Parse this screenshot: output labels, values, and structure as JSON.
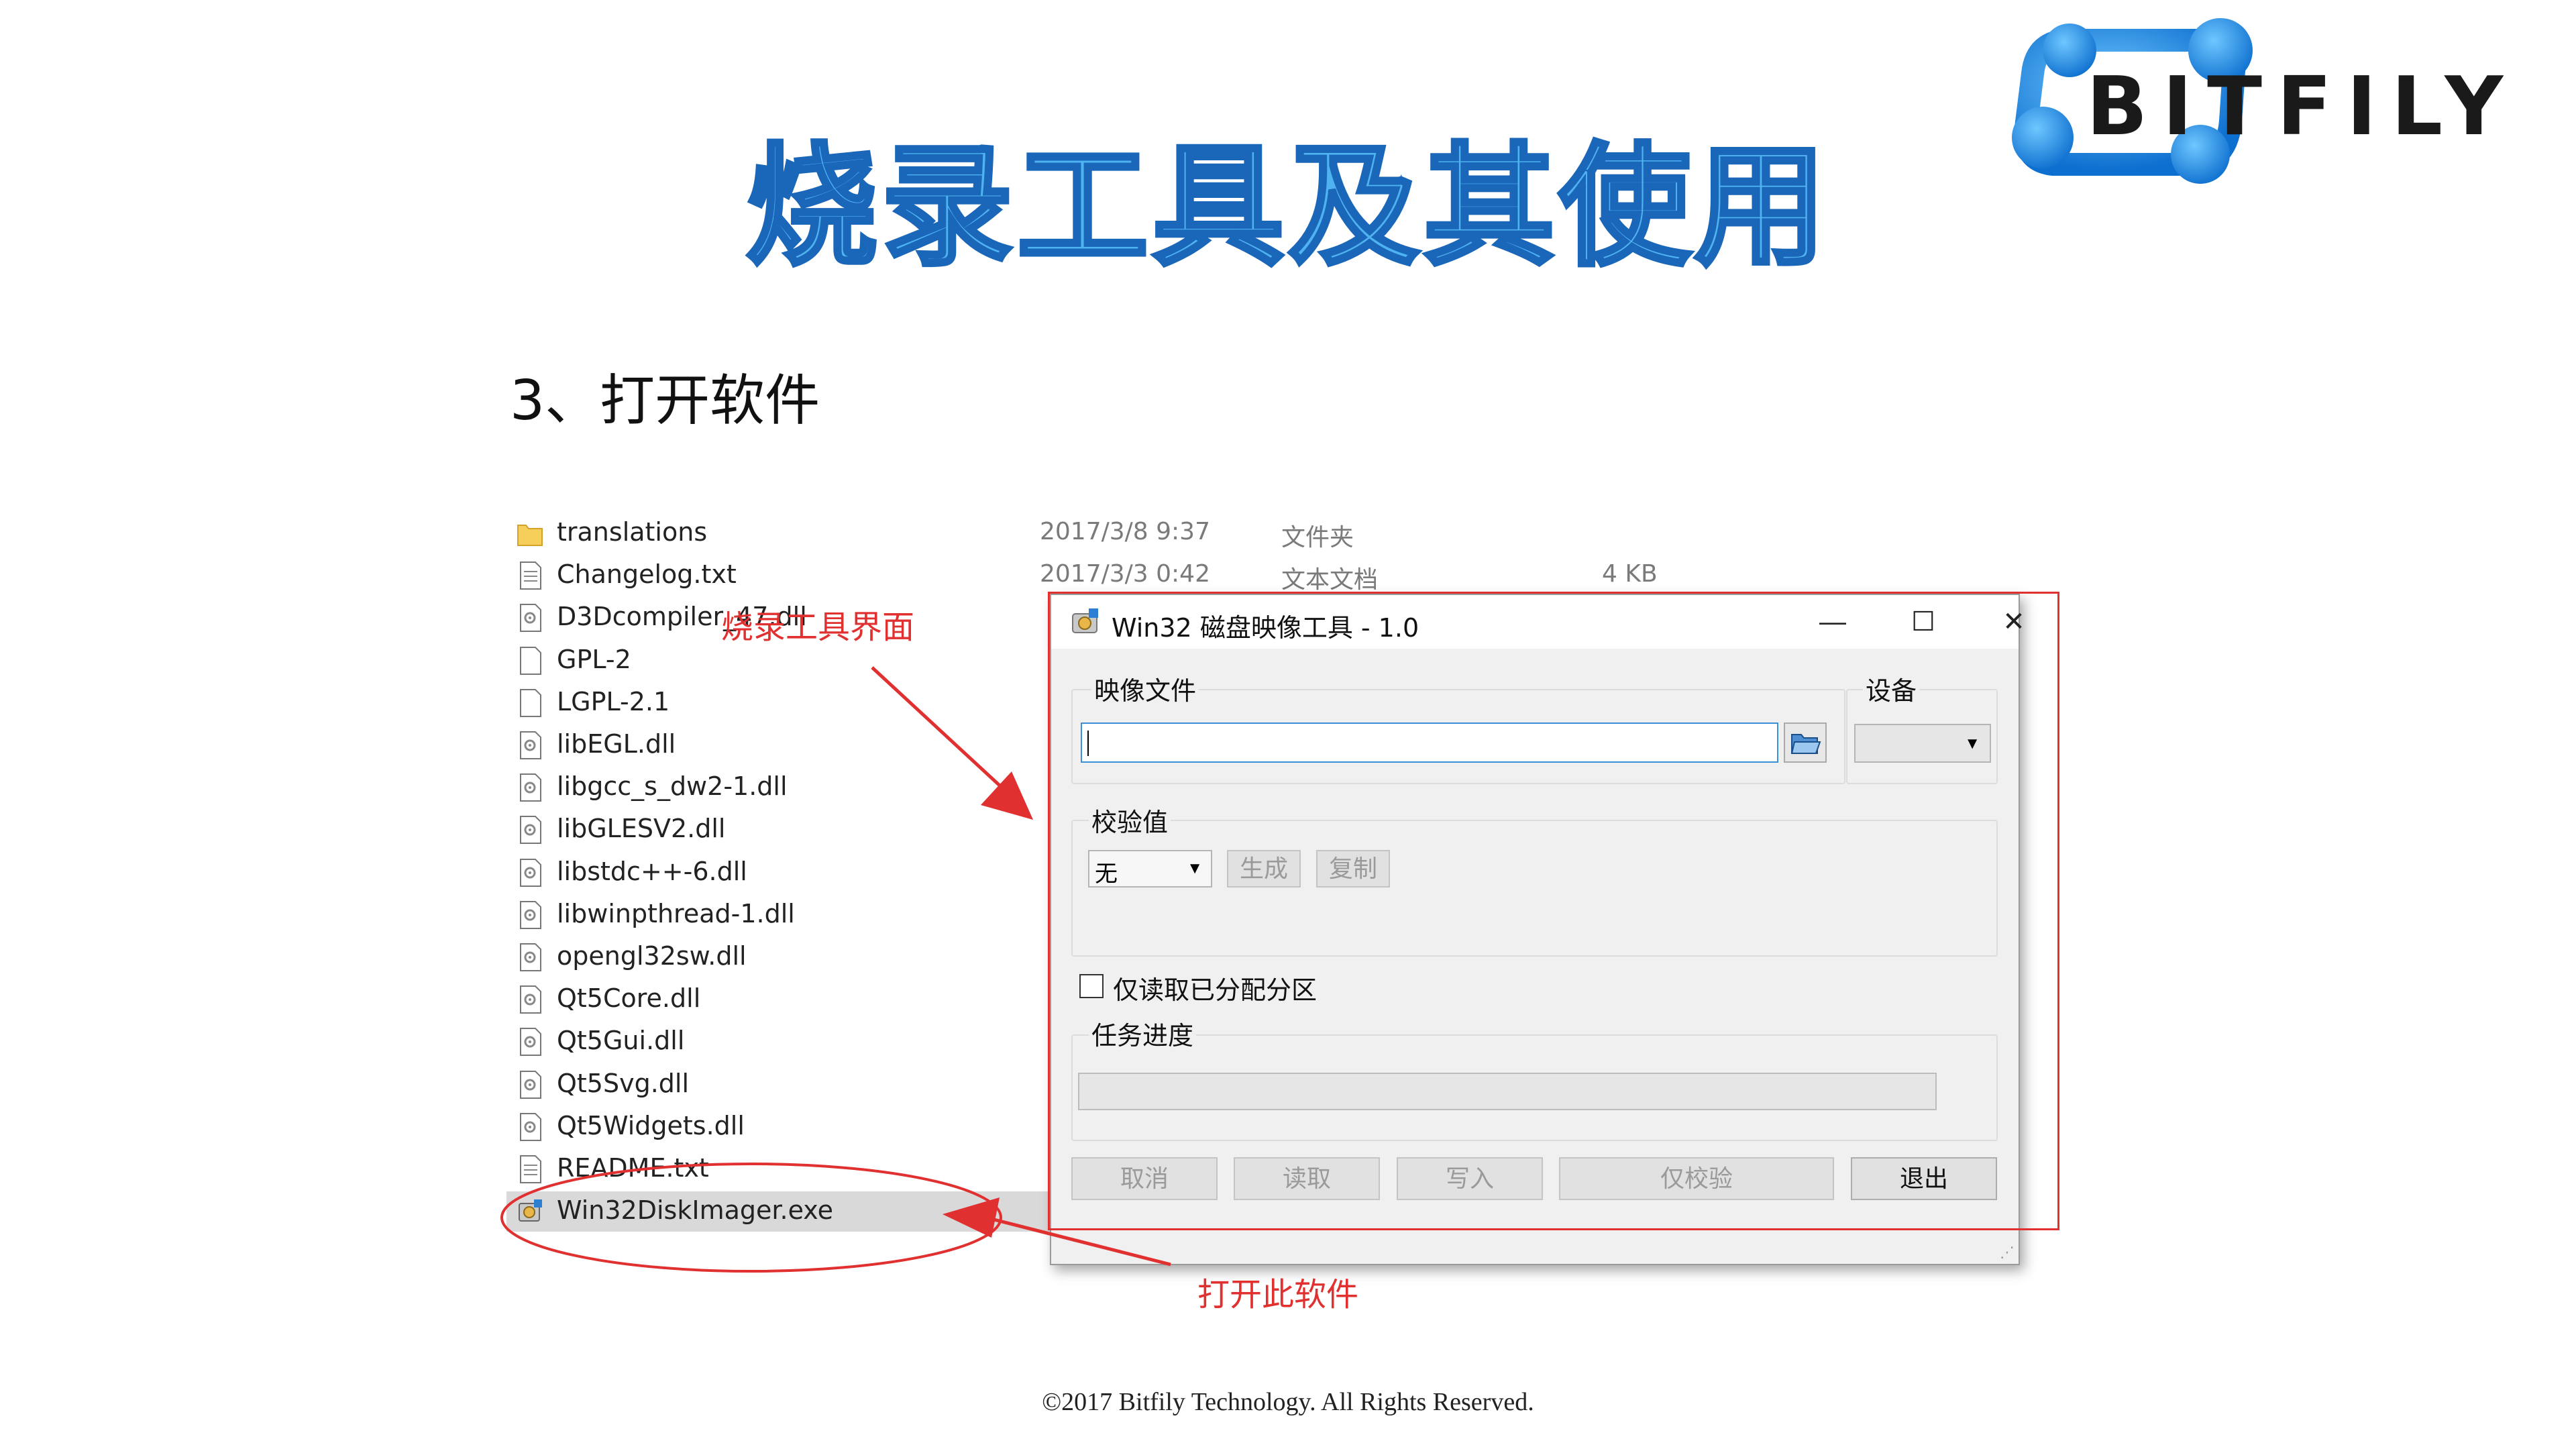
{
  "slide": {
    "title": "烧录工具及其使用",
    "step_heading": "3、打开软件",
    "footer": "©2017 Bitfily Technology. All Rights Reserved.",
    "logo_text": "BITFILY"
  },
  "file_list": [
    {
      "name": "translations",
      "icon": "folder-icon"
    },
    {
      "name": "Changelog.txt",
      "icon": "text-file-icon"
    },
    {
      "name": "D3Dcompiler_47.dll",
      "icon": "dll-file-icon"
    },
    {
      "name": "GPL-2",
      "icon": "blank-file-icon"
    },
    {
      "name": "LGPL-2.1",
      "icon": "blank-file-icon"
    },
    {
      "name": "libEGL.dll",
      "icon": "dll-file-icon"
    },
    {
      "name": "libgcc_s_dw2-1.dll",
      "icon": "dll-file-icon"
    },
    {
      "name": "libGLESV2.dll",
      "icon": "dll-file-icon"
    },
    {
      "name": "libstdc++-6.dll",
      "icon": "dll-file-icon"
    },
    {
      "name": "libwinpthread-1.dll",
      "icon": "dll-file-icon"
    },
    {
      "name": "opengl32sw.dll",
      "icon": "dll-file-icon"
    },
    {
      "name": "Qt5Core.dll",
      "icon": "dll-file-icon"
    },
    {
      "name": "Qt5Gui.dll",
      "icon": "dll-file-icon"
    },
    {
      "name": "Qt5Svg.dll",
      "icon": "dll-file-icon"
    },
    {
      "name": "Qt5Widgets.dll",
      "icon": "dll-file-icon"
    },
    {
      "name": "README.txt",
      "icon": "text-file-icon"
    },
    {
      "name": "Win32DiskImager.exe",
      "icon": "exe-file-icon",
      "selected": true
    }
  ],
  "file_meta": [
    {
      "date": "2017/3/8 9:37",
      "type": "文件夹",
      "size": ""
    },
    {
      "date": "2017/3/3 0:42",
      "type": "文本文档",
      "size": "4 KB"
    }
  ],
  "annotations": {
    "tool_ui": "烧录工具界面",
    "open_software": "打开此软件"
  },
  "dialog": {
    "title": "Win32 磁盘映像工具 - 1.0",
    "image_file_label": "映像文件",
    "image_file_value": "",
    "device_label": "设备",
    "device_value": "",
    "checksum_label": "校验值",
    "checksum_select": "无",
    "generate_button": "生成",
    "copy_button": "复制",
    "readonly_partitions_label": "仅读取已分配分区",
    "readonly_partitions_checked": false,
    "progress_label": "任务进度",
    "progress": 0,
    "buttons": {
      "cancel": "取消",
      "read": "读取",
      "write": "写入",
      "verify_only": "仅校验",
      "exit": "退出"
    }
  },
  "colors": {
    "title_fill": "#4eb3f0",
    "title_stroke": "#1a66b8",
    "annotation_red": "#e03030",
    "logo_blue": "#1e8fe0"
  }
}
